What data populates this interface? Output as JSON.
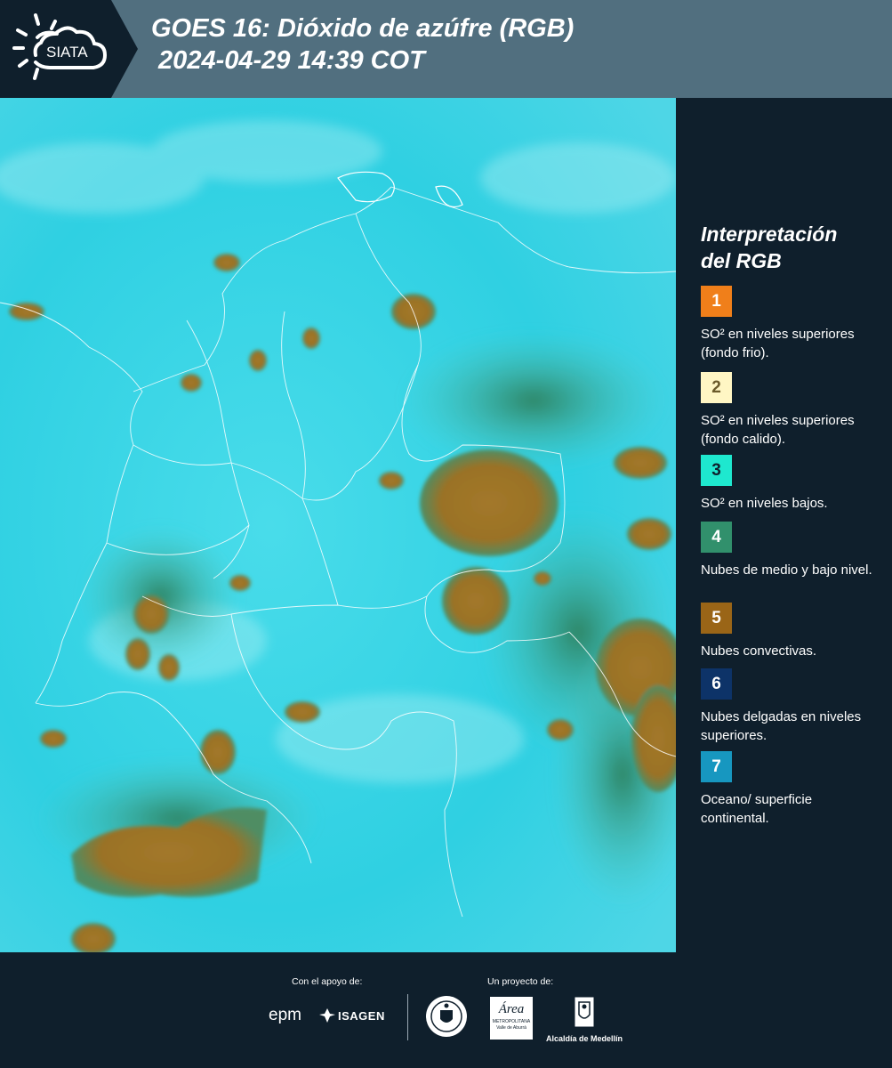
{
  "header": {
    "logo_text": "SIATA",
    "title_line1": "GOES 16: Dióxido de azúfre (RGB)",
    "title_line2": " 2024-04-29 14:39 COT"
  },
  "legend": {
    "title_line1": "Interpretación",
    "title_line2": "del RGB",
    "items": [
      {
        "num": "1",
        "label": "SO² en niveles superiores (fondo frio).",
        "color": "#f07f1a",
        "text_color": "#ffffff"
      },
      {
        "num": "2",
        "label": "SO² en niveles superiores (fondo calido).",
        "color": "#fff6c4",
        "text_color": "#6b5a2a"
      },
      {
        "num": "3",
        "label": "SO² en niveles bajos.",
        "color": "#1ee8cf",
        "text_color": "#0f1f2c"
      },
      {
        "num": "4",
        "label": "Nubes de medio y bajo nivel.",
        "color": "#31906c",
        "text_color": "#ffffff"
      },
      {
        "num": "5",
        "label": "Nubes convectivas.",
        "color": "#9a6517",
        "text_color": "#ffffff"
      },
      {
        "num": "6",
        "label": "Nubes delgadas en niveles superiores.",
        "color": "#0d3368",
        "text_color": "#ffffff"
      },
      {
        "num": "7",
        "label": "Oceano/ superficie continental.",
        "color": "#1797c0",
        "text_color": "#ffffff"
      }
    ]
  },
  "footer": {
    "support_caption": "Con el apoyo de:",
    "project_caption": "Un proyecto de:",
    "logos": {
      "epm": "epm",
      "isagen": "ISAGEN",
      "area_metro": "Área",
      "area_metro_sub": "METROPOLITANA",
      "area_metro_sub2": "Valle de Aburrá",
      "alcaldia": "Alcaldía de Medellín"
    }
  },
  "colors": {
    "background": "#0f1f2c",
    "header_bar": "#516f7f",
    "map_surface": "#33d4e3",
    "convective": "#a07a2a",
    "low_clouds": "#3b8f7a",
    "borders": "#ffffff"
  }
}
